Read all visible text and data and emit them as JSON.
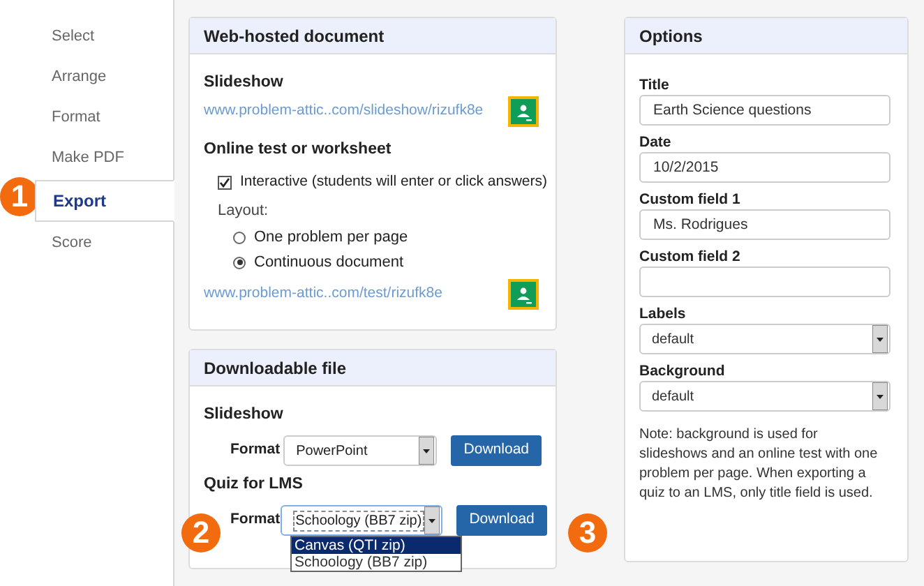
{
  "sidebar": {
    "items": [
      {
        "label": "Select",
        "selected": false
      },
      {
        "label": "Arrange",
        "selected": false
      },
      {
        "label": "Format",
        "selected": false
      },
      {
        "label": "Make PDF",
        "selected": false
      },
      {
        "label": "Export",
        "selected": true
      },
      {
        "label": "Score",
        "selected": false
      }
    ]
  },
  "callouts": [
    "1",
    "2",
    "3"
  ],
  "web_hosted": {
    "title": "Web-hosted document",
    "slideshow": {
      "heading": "Slideshow",
      "link": "www.problem-attic..com/slideshow/rizufk8e"
    },
    "online_test": {
      "heading": "Online test or worksheet",
      "interactive": {
        "label": "Interactive (students will enter or click answers)",
        "checked": true
      },
      "layout_label": "Layout:",
      "layout_options": [
        {
          "label": "One problem per page",
          "selected": false
        },
        {
          "label": "Continuous document",
          "selected": true
        }
      ],
      "link": "www.problem-attic..com/test/rizufk8e"
    }
  },
  "downloadable": {
    "title": "Downloadable file",
    "slideshow": {
      "heading": "Slideshow",
      "format_label": "Format",
      "format_value": "PowerPoint",
      "button": "Download"
    },
    "quiz": {
      "heading": "Quiz for LMS",
      "format_label": "Format",
      "format_value": "Schoology (BB7 zip)",
      "button": "Download",
      "dropdown_options": [
        {
          "label": "Canvas (QTI zip)",
          "selected": true
        },
        {
          "label": "Schoology (BB7 zip)",
          "selected": false
        }
      ]
    }
  },
  "options": {
    "title": "Options",
    "fields": [
      {
        "label": "Title",
        "kind": "text",
        "value": "Earth Science questions"
      },
      {
        "label": "Date",
        "kind": "text",
        "value": "10/2/2015"
      },
      {
        "label": "Custom field 1",
        "kind": "text",
        "value": "Ms. Rodrigues"
      },
      {
        "label": "Custom field 2",
        "kind": "text"
      },
      {
        "label": "Labels",
        "kind": "select",
        "value": "default"
      },
      {
        "label": "Background",
        "kind": "select",
        "value": "default"
      }
    ],
    "note": "Note: background is used for slideshows and an online test with one problem per page. When exporting a quiz to an LMS, only title field is used."
  }
}
